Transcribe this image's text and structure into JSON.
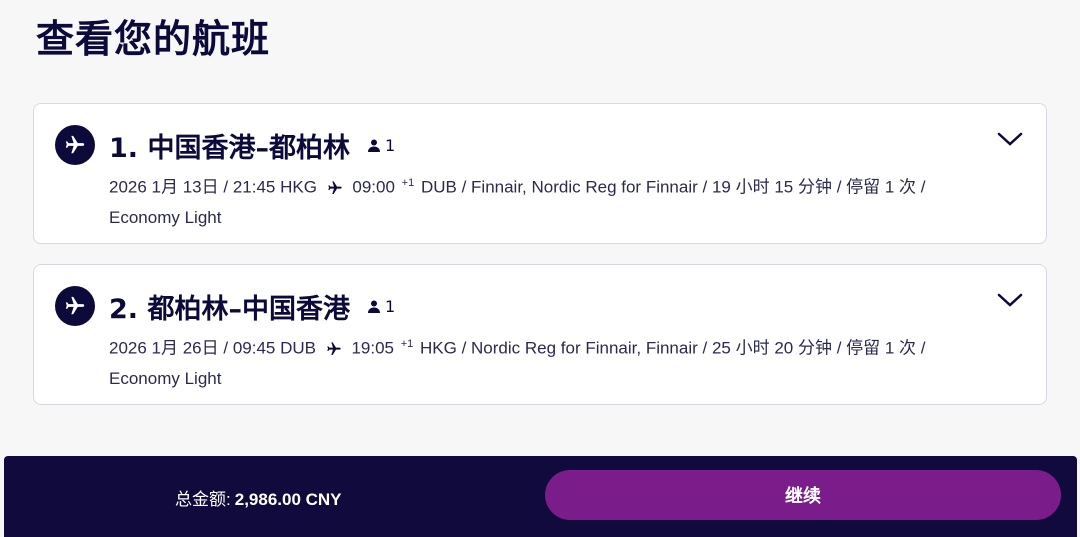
{
  "page": {
    "title": "查看您的航班"
  },
  "flights": [
    {
      "route": "1. 中国香港–都柏林",
      "passengers": "1",
      "date": "2026 1月 13日",
      "depart": "21:45 HKG",
      "arrive_time": "09:00",
      "day_offset": "+1",
      "arrive_airport": "DUB",
      "carriers": "Finnair, Nordic Reg for Finnair",
      "duration": "19 小时 15 分钟",
      "stops": "停留 1 次",
      "fare": "Economy Light",
      "icon": "plane-icon"
    },
    {
      "route": "2. 都柏林–中国香港",
      "passengers": "1",
      "date": "2026 1月 26日",
      "depart": "09:45 DUB",
      "arrive_time": "19:05",
      "day_offset": "+1",
      "arrive_airport": "HKG",
      "carriers": "Nordic Reg for Finnair, Finnair",
      "duration": "25 小时 20 分钟",
      "stops": "停留 1 次",
      "fare": "Economy Light",
      "icon": "plane-icon"
    }
  ],
  "footer": {
    "total_label": "总金额:",
    "total_value": "2,986.00 CNY",
    "continue_label": "继续"
  },
  "colors": {
    "navy": "#0b0a3a",
    "footer_bg": "#110a3c",
    "button": "#7b1c8b",
    "card_border": "#d8d8e2"
  }
}
